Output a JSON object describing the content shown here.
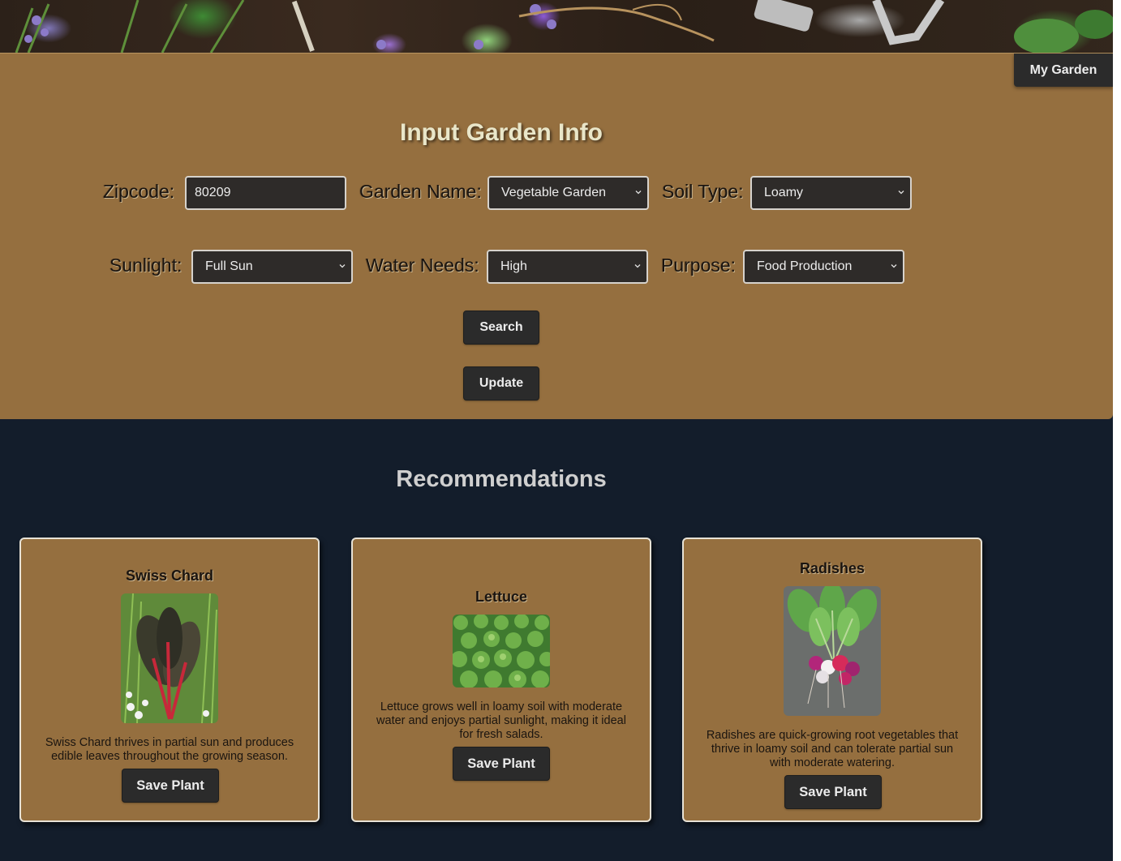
{
  "header": {
    "my_garden_label": "My Garden"
  },
  "input_form": {
    "title": "Input Garden Info",
    "fields": {
      "zipcode": {
        "label": "Zipcode:",
        "value": "80209"
      },
      "garden_name": {
        "label": "Garden Name:",
        "value": "Vegetable Garden"
      },
      "soil_type": {
        "label": "Soil Type:",
        "value": "Loamy"
      },
      "sunlight": {
        "label": "Sunlight:",
        "value": "Full Sun"
      },
      "water_needs": {
        "label": "Water Needs:",
        "value": "High"
      },
      "purpose": {
        "label": "Purpose:",
        "value": "Food Production"
      }
    },
    "search_label": "Search",
    "update_label": "Update"
  },
  "recommendations": {
    "title": "Recommendations",
    "save_label": "Save Plant",
    "plants": [
      {
        "name": "Swiss Chard",
        "description": "Swiss Chard thrives in partial sun and produces edible leaves throughout the growing season."
      },
      {
        "name": "Lettuce",
        "description": "Lettuce grows well in loamy soil with moderate water and enjoys partial sunlight, making it ideal for fresh salads."
      },
      {
        "name": "Radishes",
        "description": "Radishes are quick-growing root vegetables that thrive in loamy soil and can tolerate partial sun with moderate watering."
      }
    ]
  },
  "colors": {
    "panel": "#956f3f",
    "page_background": "#131d2b",
    "button": "#2b2b2b"
  }
}
